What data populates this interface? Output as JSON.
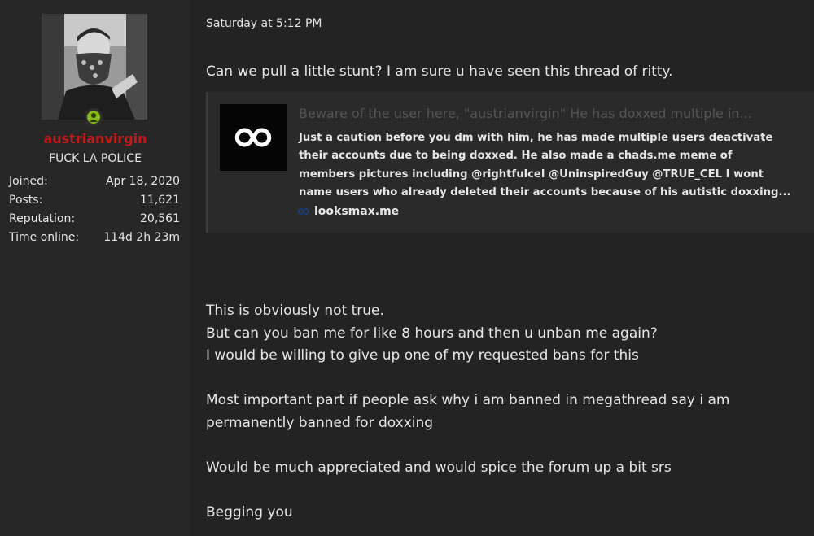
{
  "user": {
    "username": "austrianvirgin",
    "title": "FUCK LA POLICE",
    "stats": [
      {
        "label": "Joined:",
        "value": "Apr 18, 2020"
      },
      {
        "label": "Posts:",
        "value": "11,621"
      },
      {
        "label": "Reputation:",
        "value": "20,561"
      },
      {
        "label": "Time online:",
        "value": "114d 2h 23m"
      }
    ]
  },
  "post": {
    "date": "Saturday at 5:12 PM",
    "intro": "Can we pull a little stunt? I am sure u have seen this thread of ritty.",
    "embed": {
      "title": "Beware of the user here, \"austrianvirgin\" He has doxxed multiple in...",
      "snippet_lines": [
        "Just a caution before you dm with him, he has made multiple users deactivate",
        "their accounts due to being doxxed. He also made a chads.me meme of",
        "members pictures including @rightfulcel @UninspiredGuy @TRUE_CEL I wont",
        "name users who already deleted their accounts because of his autistic doxxing..."
      ],
      "domain": "looksmax.me"
    },
    "body_lines": [
      "This is obviously not true.",
      "But can you ban me for like 8 hours and then u unban me again?",
      "I would be willing to give up one of my requested bans for this",
      "",
      "Most important part if people ask why i am banned in megathread say i am",
      "permanently banned for doxxing",
      "",
      "Would be much appreciated and would spice the forum up a bit srs",
      "",
      "Begging you"
    ]
  },
  "colors": {
    "username": "#c21a1a",
    "online": "#86b817",
    "background": "#232323"
  }
}
